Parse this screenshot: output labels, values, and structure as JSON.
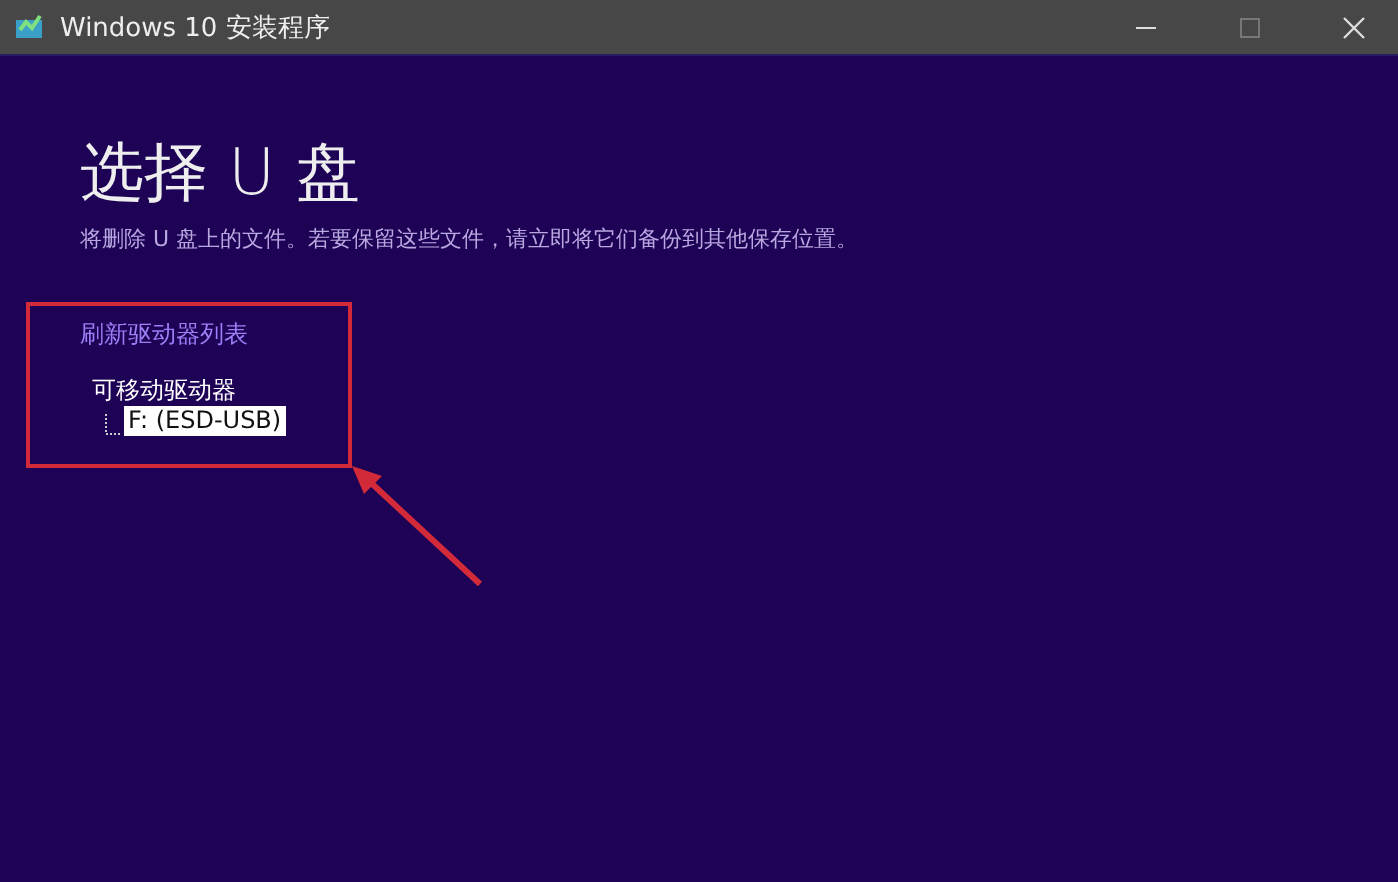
{
  "window": {
    "title": "Windows 10 安装程序"
  },
  "heading": "选择 U 盘",
  "subtitle": "将删除 U 盘上的文件。若要保留这些文件，请立即将它们备份到其他保存位置。",
  "refresh_link": "刷新驱动器列表",
  "tree": [
    {
      "label": "可移动驱动器",
      "selected": false,
      "children": [
        {
          "label": "F: (ESD-USB)",
          "selected": true
        }
      ]
    }
  ]
}
